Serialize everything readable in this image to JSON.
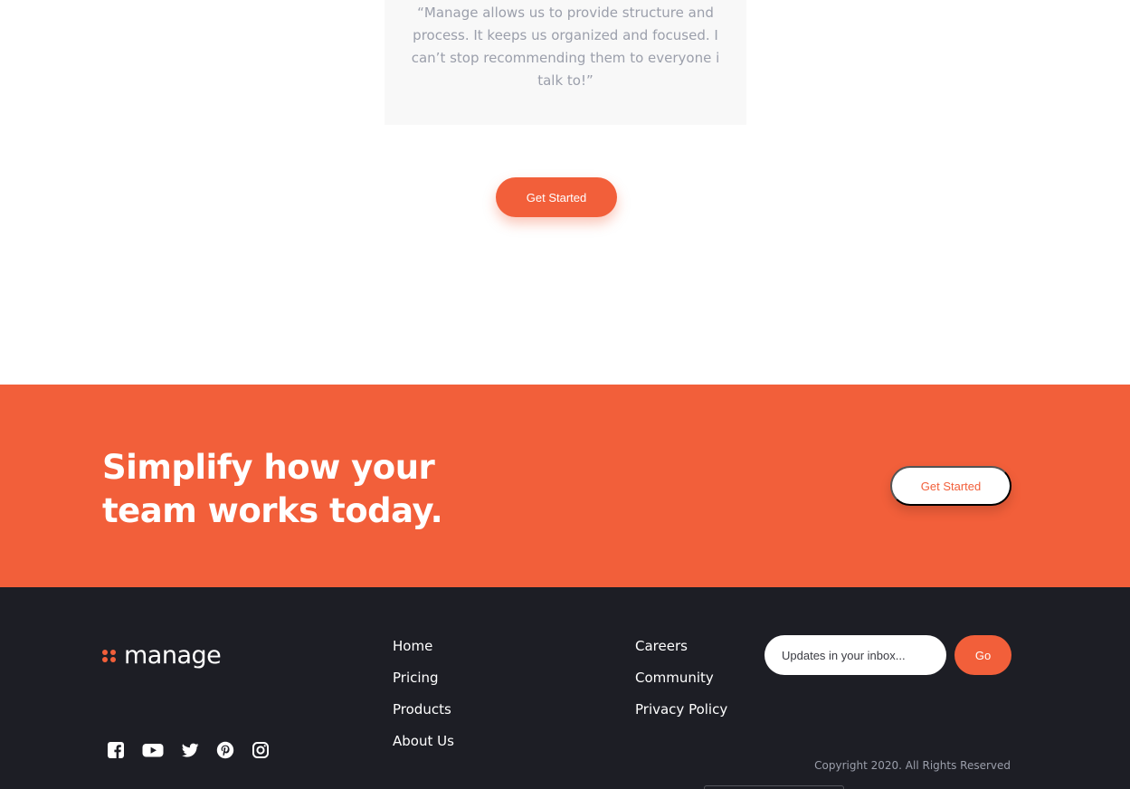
{
  "testimonial": {
    "quote": "“Manage allows us to provide structure and process. It keeps us organized and focused. I can’t stop recommending them to everyone i talk to!”"
  },
  "hero": {
    "cta_label": "Get Started"
  },
  "cta_band": {
    "heading": "Simplify how your team works today.",
    "cta_label": "Get Started",
    "background_color": "#f25f3a"
  },
  "footer": {
    "logo_text": "manage",
    "social_icons": [
      "facebook-icon",
      "youtube-icon",
      "twitter-icon",
      "pinterest-icon",
      "instagram-icon"
    ],
    "nav_primary": [
      "Home",
      "Pricing",
      "Products",
      "About Us"
    ],
    "nav_secondary": [
      "Careers",
      "Community",
      "Privacy Policy"
    ],
    "newsletter": {
      "placeholder": "Updates in your inbox...",
      "button_label": "Go"
    },
    "copyright": "Copyright 2020. All Rights Reserved",
    "background_color": "#1d1e25"
  },
  "colors": {
    "accent": "#f25f3a",
    "muted_text": "#9b9fab"
  }
}
